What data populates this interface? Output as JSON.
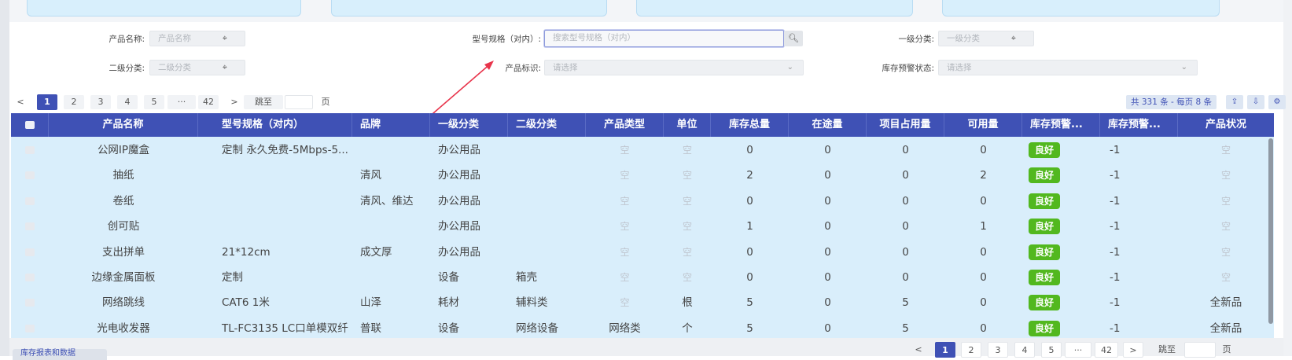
{
  "filters": {
    "product_name": {
      "label": "产品名称:",
      "placeholder": "产品名称"
    },
    "model_spec": {
      "label": "型号规格（对内）:",
      "placeholder": "搜索型号规格（对内）"
    },
    "level1": {
      "label": "一级分类:",
      "placeholder": "一级分类"
    },
    "level2": {
      "label": "二级分类:",
      "placeholder": "二级分类"
    },
    "product_tag": {
      "label": "产品标识:",
      "placeholder": "请选择"
    },
    "stock_warning_status": {
      "label": "库存预警状态:",
      "placeholder": "请选择"
    }
  },
  "pagination_top": {
    "prev": "<",
    "next": ">",
    "pages": [
      "1",
      "2",
      "3",
      "4",
      "5",
      "···",
      "42"
    ],
    "current": "1",
    "jump_label": "跳至",
    "page_suffix": "页",
    "total_text": "共 331 条 - 每页 8 条"
  },
  "pagination_bottom": {
    "prev": "<",
    "next": ">",
    "pages": [
      "1",
      "2",
      "3",
      "4",
      "5",
      "···",
      "42"
    ],
    "current": "1",
    "jump_label": "跳至",
    "page_suffix": "页"
  },
  "bottom_tab_label": "库存报表和数据",
  "table": {
    "columns": [
      "产品名称",
      "型号规格（对内）",
      "品牌",
      "一级分类",
      "二级分类",
      "产品类型",
      "单位",
      "库存总量",
      "在途量",
      "项目占用量",
      "可用量",
      "库存预警...",
      "库存预警...",
      "产品状况"
    ],
    "rows": [
      [
        "公网IP魔盒",
        "定制 永久免费-5Mbps-5...",
        "",
        "办公用品",
        "",
        "空",
        "空",
        "0",
        "0",
        "0",
        "0",
        "良好",
        "-1",
        "空"
      ],
      [
        "抽纸",
        "",
        "清风",
        "办公用品",
        "",
        "空",
        "空",
        "2",
        "0",
        "0",
        "2",
        "良好",
        "-1",
        "空"
      ],
      [
        "卷纸",
        "",
        "清风、维达",
        "办公用品",
        "",
        "空",
        "空",
        "0",
        "0",
        "0",
        "0",
        "良好",
        "-1",
        "空"
      ],
      [
        "创可贴",
        "",
        "",
        "办公用品",
        "",
        "空",
        "空",
        "1",
        "0",
        "0",
        "1",
        "良好",
        "-1",
        "空"
      ],
      [
        "支出拼单",
        "21*12cm",
        "成文厚",
        "办公用品",
        "",
        "空",
        "空",
        "0",
        "0",
        "0",
        "0",
        "良好",
        "-1",
        "空"
      ],
      [
        "边缘金属面板",
        "定制",
        "",
        "设备",
        "箱壳",
        "空",
        "空",
        "0",
        "0",
        "0",
        "0",
        "良好",
        "-1",
        "空"
      ],
      [
        "网络跳线",
        "CAT6 1米",
        "山泽",
        "耗材",
        "辅料类",
        "空",
        "根",
        "5",
        "0",
        "5",
        "0",
        "良好",
        "-1",
        "全新品"
      ],
      [
        "光电收发器",
        "TL-FC3135 LC口单模双纤",
        "普联",
        "设备",
        "网络设备",
        "网络类",
        "个",
        "5",
        "0",
        "5",
        "0",
        "良好",
        "-1",
        "全新品"
      ]
    ]
  },
  "colors": {
    "header": "#3f51b5",
    "row_bg": "#d9eefb",
    "badge": "#52b81f",
    "arrow": "#e8344b"
  }
}
